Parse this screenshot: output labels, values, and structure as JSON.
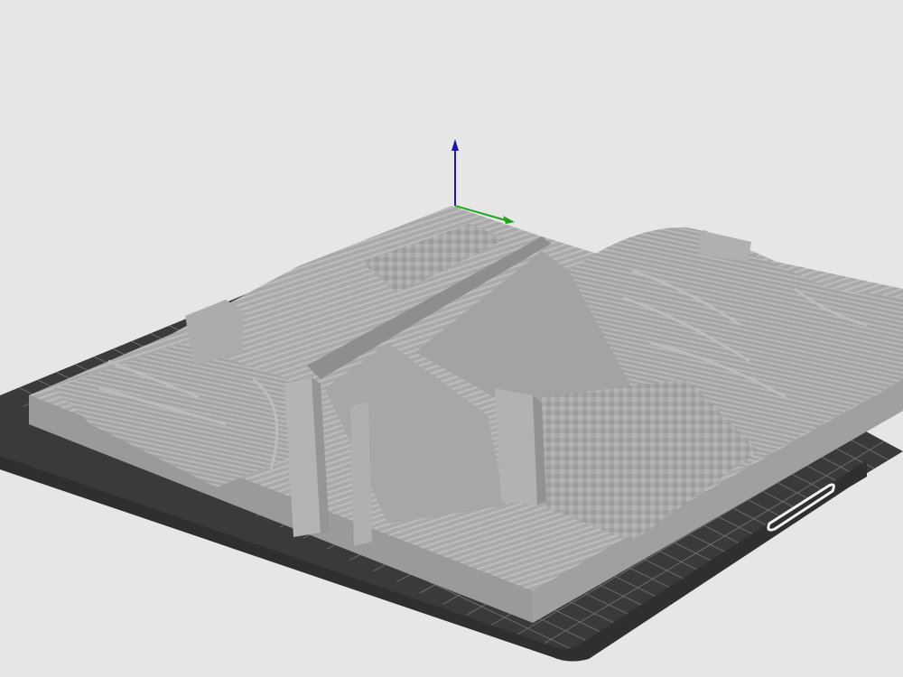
{
  "app": {
    "view": "3D preview",
    "theme_background": "#e6e6e6"
  },
  "bed": {
    "surface_color": "#3a3a3a",
    "grid_color": "#6b6b6b",
    "border_color": "#2b2b2b",
    "handle_color": "#f2f2f2",
    "logo_icon": "printer-brand-logo-icon"
  },
  "model": {
    "color": "#aaaaaa",
    "shade_light": "#bdbdbd",
    "shade_mid": "#a6a6a6",
    "shade_dark": "#8e8e8e",
    "shade_side": "#9a9a9a",
    "description_icon": "terrain-model-icon"
  },
  "gizmo": {
    "z_axis_color": "#1a1aa8",
    "x_axis_color": "#1ea51e",
    "z_icon": "z-axis-arrow-icon",
    "x_icon": "x-axis-arrow-icon"
  }
}
